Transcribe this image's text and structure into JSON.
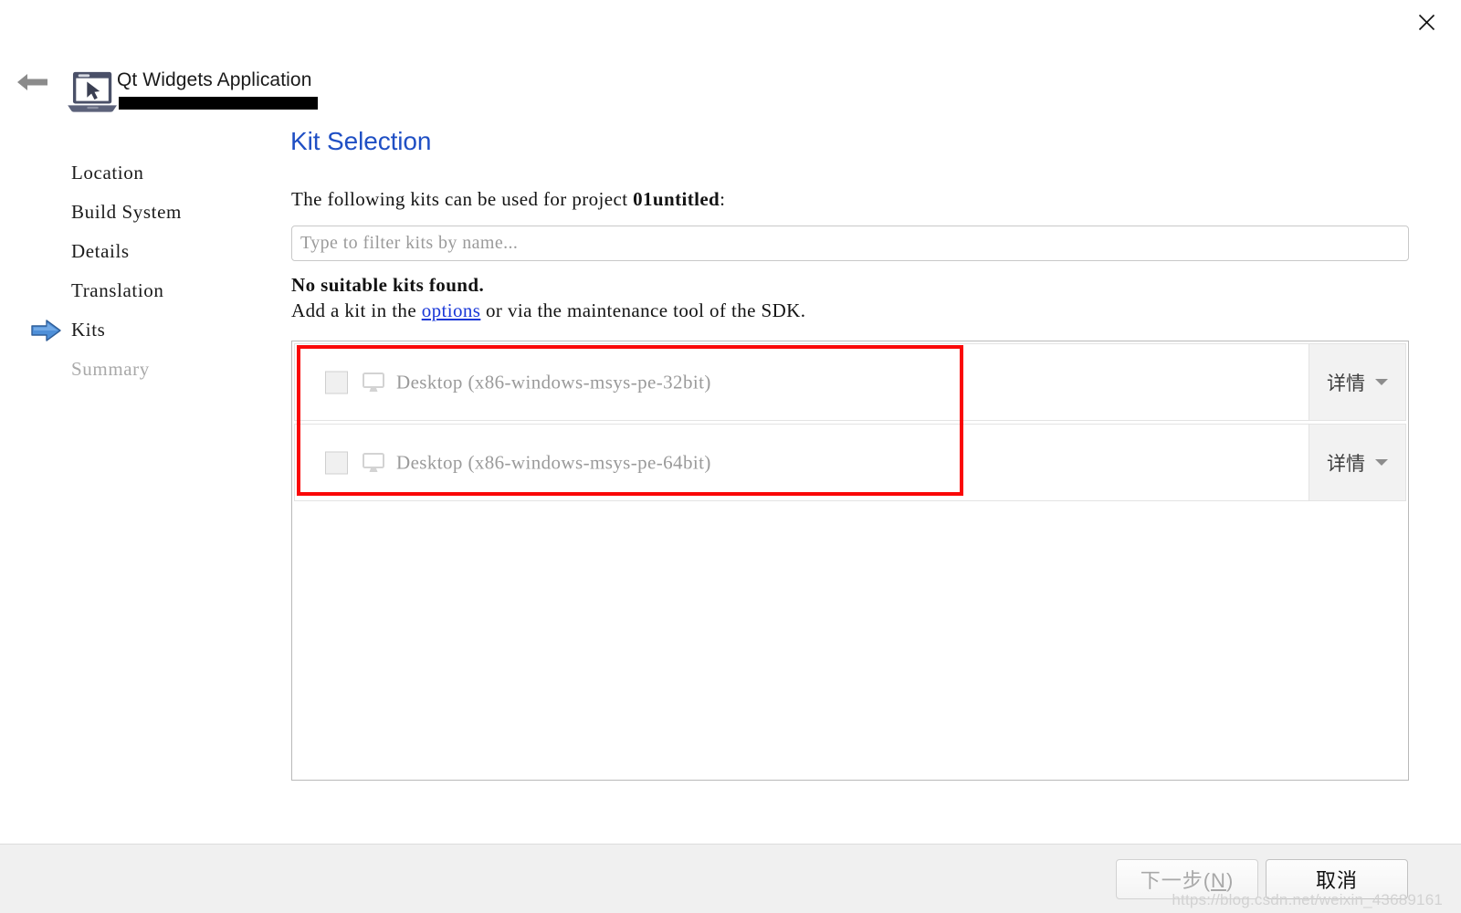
{
  "window": {
    "close_label": "✕",
    "back_label": "←"
  },
  "header": {
    "title": "Qt Widgets Application",
    "icon": "laptop-cursor-icon"
  },
  "sidebar": {
    "items": [
      {
        "label": "Location",
        "state": "done",
        "current": false
      },
      {
        "label": "Build System",
        "state": "done",
        "current": false
      },
      {
        "label": "Details",
        "state": "done",
        "current": false
      },
      {
        "label": "Translation",
        "state": "done",
        "current": false
      },
      {
        "label": "Kits",
        "state": "current",
        "current": true
      },
      {
        "label": "Summary",
        "state": "pending",
        "current": false
      }
    ]
  },
  "main": {
    "page_title": "Kit Selection",
    "intro_prefix": "The following kits can be used for project ",
    "project_name": "01untitled",
    "intro_suffix": ":",
    "filter_placeholder": "Type to filter kits by name...",
    "filter_value": "",
    "no_kits_heading": "No suitable kits found.",
    "add_kit_prefix": "Add a kit in the ",
    "add_kit_link": "options",
    "add_kit_suffix": " or via the maintenance tool of the SDK.",
    "kits": [
      {
        "name": "Desktop (x86-windows-msys-pe-32bit)",
        "checked": false,
        "enabled": false,
        "icon": "desktop-monitor-icon",
        "details_label": "详情"
      },
      {
        "name": "Desktop (x86-windows-msys-pe-64bit)",
        "checked": false,
        "enabled": false,
        "icon": "desktop-monitor-icon",
        "details_label": "详情"
      }
    ]
  },
  "footer": {
    "next_label_text": "下一步(",
    "next_accel": "N",
    "next_label_end": ")",
    "cancel_label": "取消"
  },
  "watermark": {
    "text": "https://blog.csdn.net/weixin_43689161"
  },
  "colors": {
    "title_blue": "#1f4fc4",
    "link_blue": "#1a38d8",
    "highlight_red": "#fa0808",
    "disabled_gray": "#a9a9a9",
    "kit_text_gray": "#9a9a9a"
  }
}
